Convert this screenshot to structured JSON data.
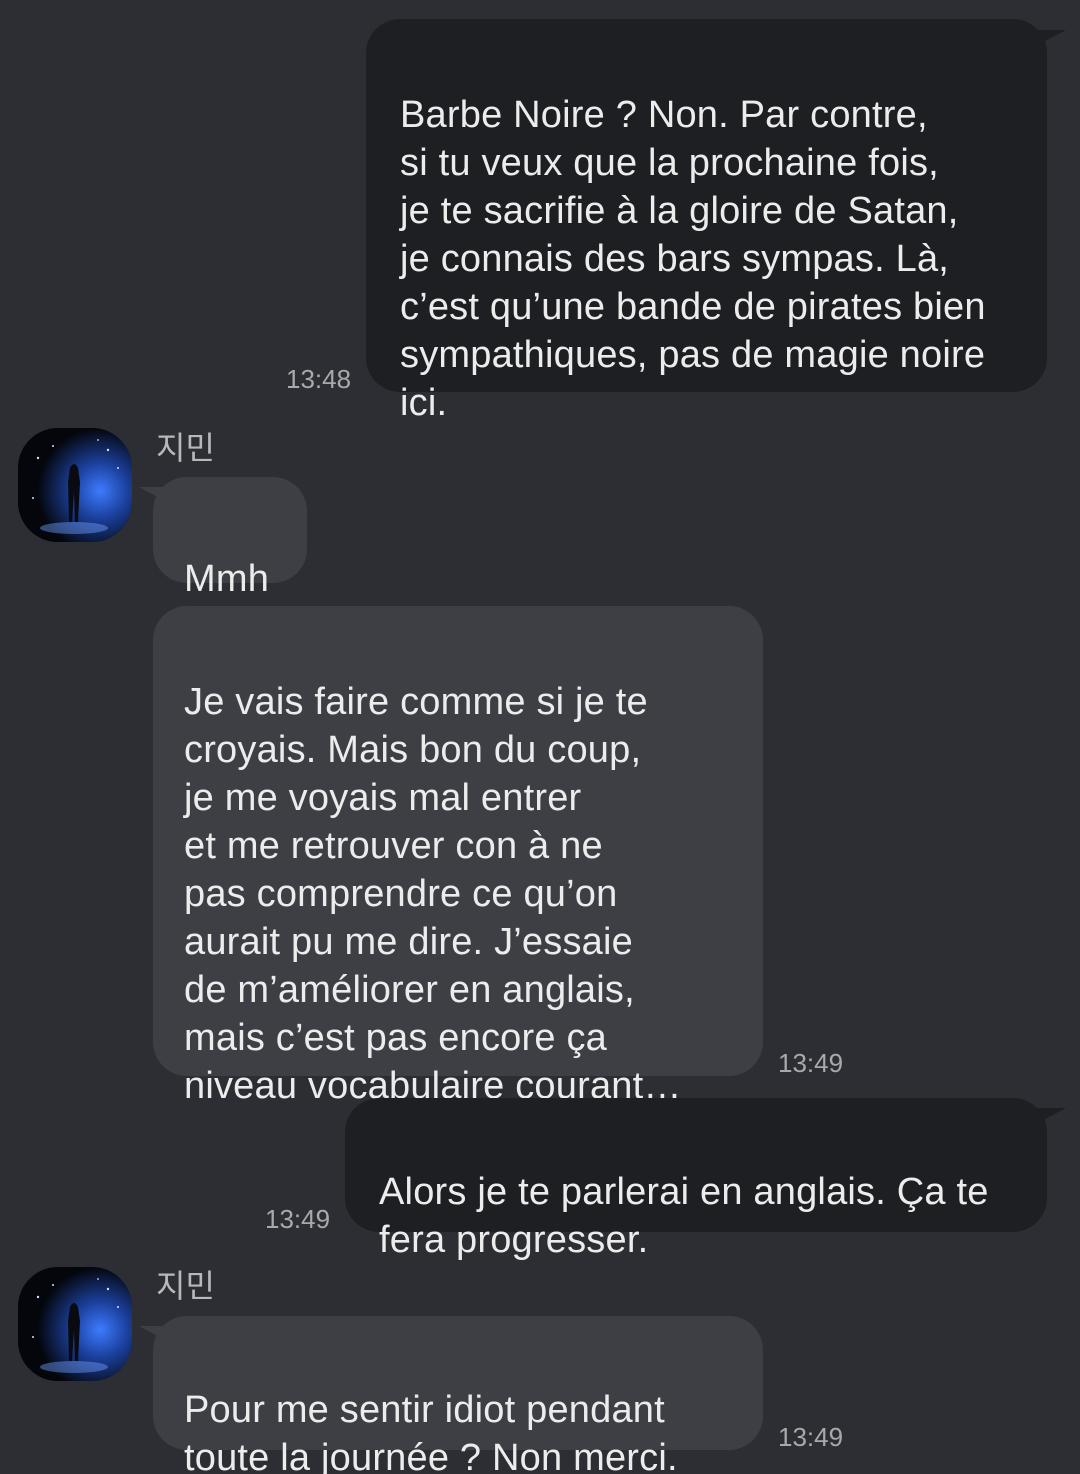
{
  "messages": [
    {
      "direction": "outgoing",
      "text": "Barbe Noire ? Non. Par contre,\nsi tu veux que la prochaine fois,\nje te sacrifie à la gloire de Satan,\nje connais des bars sympas. Là,\nc’est qu’une bande de pirates bien\nsympathiques, pas de magie noire\nici.",
      "time": "13:48"
    },
    {
      "direction": "incoming",
      "sender": "지민",
      "text": "Mmh"
    },
    {
      "direction": "incoming",
      "text": "Je vais faire comme si je te\ncroyais. Mais bon du coup,\nje me voyais mal entrer\net me retrouver con à ne\npas comprendre ce qu’on\naurait pu me dire. J’essaie\nde m’améliorer en anglais,\nmais c’est pas encore ça\nniveau vocabulaire courant…",
      "time": "13:49"
    },
    {
      "direction": "outgoing",
      "text": "Alors je te parlerai en anglais. Ça te\nfera progresser.",
      "time": "13:49"
    },
    {
      "direction": "incoming",
      "sender": "지민",
      "text": "Pour me sentir idiot pendant\ntoute la journée ? Non merci.",
      "time": "13:49"
    }
  ],
  "colors": {
    "background": "#2c2e33",
    "outgoing_bubble": "#1e1f22",
    "incoming_bubble": "#3d3f45",
    "message_text": "#ececec",
    "timestamp": "#a7a9ad"
  },
  "avatar_icon": "profile-photo-concert-stage"
}
